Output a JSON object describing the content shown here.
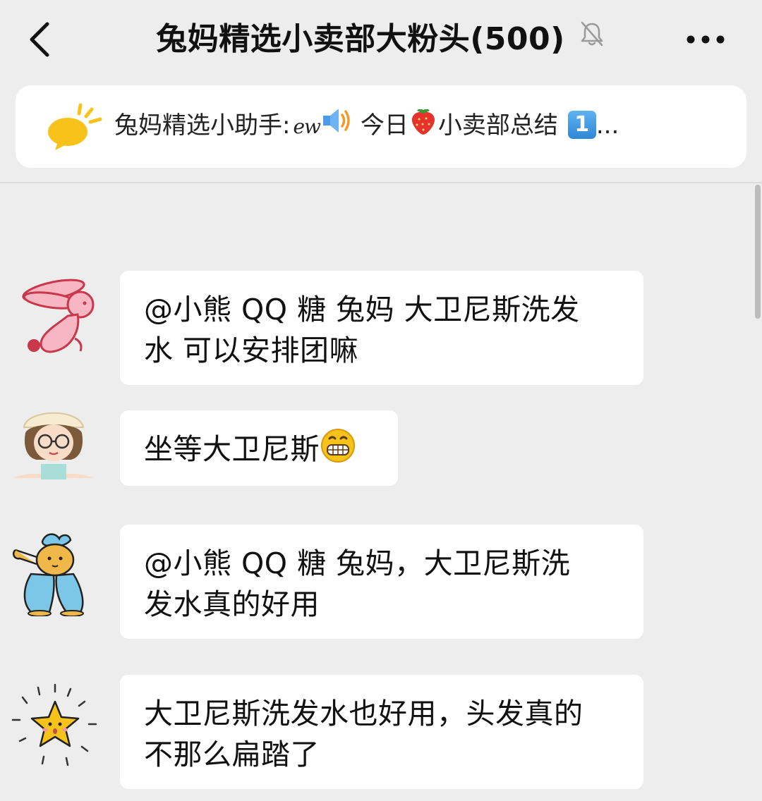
{
  "header": {
    "title": "兔妈精选小卖部大粉头(500)",
    "back_icon": "chevron-left-icon",
    "mute_icon": "bell-off-icon",
    "more_icon": "more-horizontal-icon"
  },
  "pinned": {
    "icon": "announcement-bubble-icon",
    "sender": "兔妈精选小助手:",
    "ew": "ew",
    "speaker_icon": "speaker-icon",
    "text_a": "今日",
    "strawberry_icon": "strawberry-icon",
    "text_b": "小卖部总结",
    "number_badge": "1",
    "ellipsis": "..."
  },
  "messages": [
    {
      "avatar": "pink-rabbit-avatar",
      "lines": [
        "@小熊 QQ 糖  兔妈 大卫尼斯洗发",
        "水 可以安排团嘛"
      ]
    },
    {
      "avatar": "girl-glasses-avatar",
      "lines": [
        "坐等大卫尼斯"
      ],
      "emoji": "grin-emoji-icon"
    },
    {
      "avatar": "cartoon-bear-avatar",
      "lines": [
        "@小熊 QQ 糖  兔妈，大卫尼斯洗",
        "发水真的好用"
      ]
    },
    {
      "avatar": "star-face-avatar",
      "lines": [
        "大卫尼斯洗发水也好用，头发真的",
        "不那么扁踏了"
      ]
    }
  ],
  "colors": {
    "background": "#ededed",
    "bubble": "#ffffff",
    "text": "#111111"
  }
}
